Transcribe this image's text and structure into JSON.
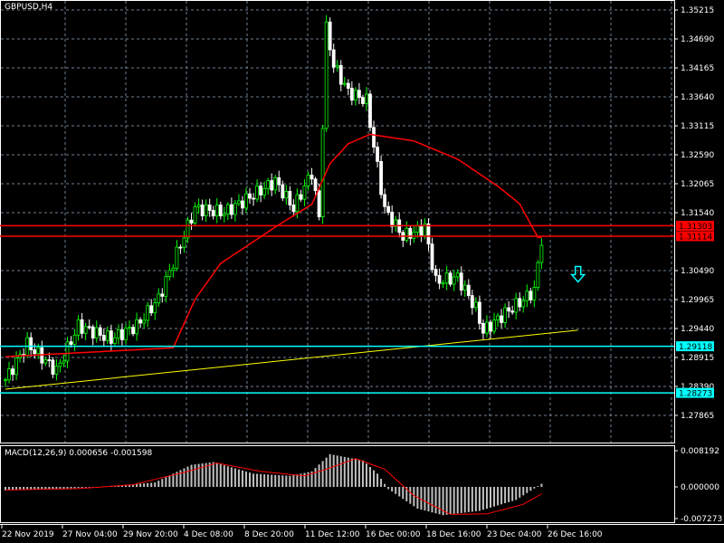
{
  "chart_data": {
    "type": "candlestick",
    "title": "GBPUSD,H4",
    "symbol": "GBPUSD",
    "timeframe": "H4",
    "ylim": [
      1.2765,
      1.3539
    ],
    "y_ticks": [
      "1.35215",
      "1.34690",
      "1.34165",
      "1.33640",
      "1.33115",
      "1.32590",
      "1.32065",
      "1.31540",
      "1.30490",
      "1.29965",
      "1.29440",
      "1.28915",
      "1.28390",
      "1.27865"
    ],
    "x_ticks": [
      "22 Nov 2019",
      "27 Nov 04:00",
      "29 Nov 20:00",
      "4 Dec 08:00",
      "8 Dec 20:00",
      "11 Dec 12:00",
      "16 Dec 00:00",
      "18 Dec 16:00",
      "23 Dec 04:00",
      "26 Dec 16:00"
    ],
    "bar_count": 148,
    "close_waypoints": [
      [
        0,
        1.2851
      ],
      [
        6,
        1.2916
      ],
      [
        14,
        1.2867
      ],
      [
        20,
        1.2949
      ],
      [
        29,
        1.2925
      ],
      [
        36,
        1.2949
      ],
      [
        42,
        1.2998
      ],
      [
        47,
        1.308
      ],
      [
        52,
        1.3162
      ],
      [
        60,
        1.3154
      ],
      [
        66,
        1.3178
      ],
      [
        74,
        1.3211
      ],
      [
        79,
        1.3162
      ],
      [
        84,
        1.3227
      ],
      [
        86,
        1.3145
      ],
      [
        88,
        1.3488
      ],
      [
        90,
        1.3422
      ],
      [
        94,
        1.3373
      ],
      [
        99,
        1.3357
      ],
      [
        101,
        1.3275
      ],
      [
        104,
        1.316
      ],
      [
        109,
        1.3111
      ],
      [
        115,
        1.3127
      ],
      [
        118,
        1.3029
      ],
      [
        124,
        1.3037
      ],
      [
        129,
        1.298
      ],
      [
        131,
        1.2939
      ],
      [
        137,
        1.2972
      ],
      [
        142,
        1.2996
      ],
      [
        145,
        1.3013
      ],
      [
        147,
        1.3106
      ]
    ],
    "ma_waypoints": [
      [
        0,
        1.2893
      ],
      [
        46,
        1.2909
      ],
      [
        52,
        1.2997
      ],
      [
        59,
        1.3062
      ],
      [
        74,
        1.3128
      ],
      [
        84,
        1.3169
      ],
      [
        89,
        1.3243
      ],
      [
        94,
        1.3279
      ],
      [
        100,
        1.3296
      ],
      [
        112,
        1.3284
      ],
      [
        124,
        1.3251
      ],
      [
        135,
        1.3202
      ],
      [
        141,
        1.317
      ],
      [
        146,
        1.3109
      ]
    ],
    "price_labels": [
      {
        "value": "1.31303",
        "color": "#ff0000"
      },
      {
        "value": "1.31114",
        "color": "#ff0000"
      },
      {
        "value": "1.29118",
        "color": "#00ffff"
      },
      {
        "value": "1.28273",
        "color": "#00ffff"
      }
    ],
    "trendline": {
      "from": [
        0,
        1.2834
      ],
      "to": [
        157,
        1.2941
      ],
      "color": "#ffff00"
    },
    "arrow": {
      "type": "down",
      "bar": 157,
      "price": 1.304,
      "color": "#00ffff"
    },
    "macd": {
      "label": "MACD(12,26,9) 0.000656 -0.001598",
      "y_ticks": [
        "0.008192",
        "0.000000",
        "-0.007273"
      ],
      "ylim": [
        -0.0078,
        0.009
      ],
      "hist_waypoints": [
        [
          0,
          -0.0008
        ],
        [
          14,
          -0.0005
        ],
        [
          26,
          0.0
        ],
        [
          41,
          0.001
        ],
        [
          51,
          0.005
        ],
        [
          57,
          0.0056
        ],
        [
          68,
          0.003
        ],
        [
          78,
          0.0025
        ],
        [
          84,
          0.0035
        ],
        [
          89,
          0.0074
        ],
        [
          98,
          0.006
        ],
        [
          102,
          0.003
        ],
        [
          105,
          -0.0005
        ],
        [
          113,
          -0.005
        ],
        [
          120,
          -0.0065
        ],
        [
          130,
          -0.0055
        ],
        [
          140,
          -0.003
        ],
        [
          147,
          0.0007
        ]
      ],
      "signal_waypoints": [
        [
          0,
          -0.0007
        ],
        [
          20,
          -0.0004
        ],
        [
          35,
          0.0005
        ],
        [
          50,
          0.0035
        ],
        [
          58,
          0.0054
        ],
        [
          70,
          0.0035
        ],
        [
          82,
          0.0025
        ],
        [
          88,
          0.004
        ],
        [
          96,
          0.0064
        ],
        [
          104,
          0.004
        ],
        [
          112,
          -0.002
        ],
        [
          122,
          -0.0063
        ],
        [
          132,
          -0.0062
        ],
        [
          142,
          -0.004
        ],
        [
          147,
          -0.0016
        ]
      ]
    },
    "colors": {
      "bull": "#00ff00",
      "bear": "#ffffff",
      "ma": "#ff0000",
      "hist": "#c0c0c0",
      "signal": "#ff0000",
      "grid": "#708090"
    }
  }
}
